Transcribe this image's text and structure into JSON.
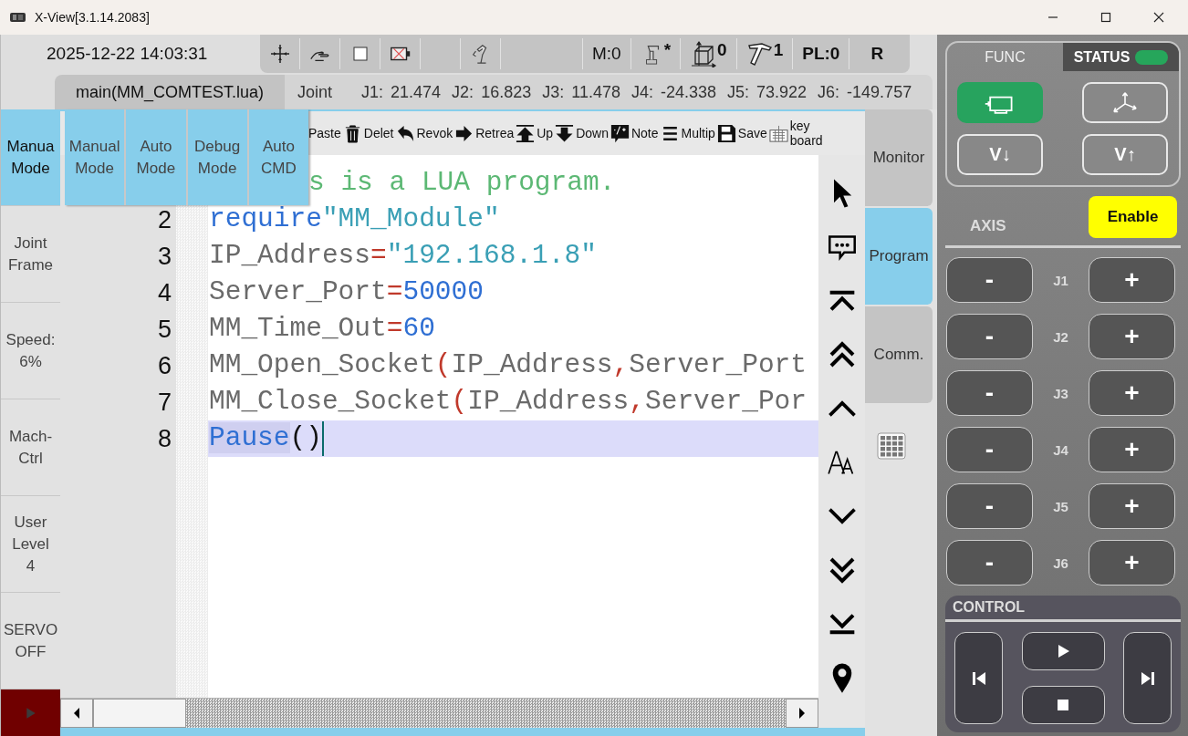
{
  "window": {
    "title": "X-View[3.1.14.2083]"
  },
  "header": {
    "datetime": "2025-12-22 14:03:31",
    "status": [
      {
        "kind": "plain",
        "text": "M:0"
      },
      {
        "kind": "robot",
        "text": "*"
      },
      {
        "kind": "frame",
        "text": "0"
      },
      {
        "kind": "tool",
        "text": "1"
      },
      {
        "kind": "bold",
        "text": "PL:0"
      },
      {
        "kind": "bold",
        "text": "R"
      }
    ]
  },
  "file_tab": {
    "label": "main(MM_COMTEST.lua)"
  },
  "joint_readout": {
    "label": "Joint",
    "values": [
      {
        "name": "J1:",
        "value": "21.474"
      },
      {
        "name": "J2:",
        "value": "16.823"
      },
      {
        "name": "J3:",
        "value": "11.478"
      },
      {
        "name": "J4:",
        "value": "-24.338"
      },
      {
        "name": "J5:",
        "value": "73.922"
      },
      {
        "name": "J6:",
        "value": "-149.757"
      }
    ]
  },
  "sidebar": [
    {
      "lines": [
        "Manua",
        "Mode"
      ],
      "selected": true
    },
    {
      "lines": [
        "Joint",
        "Frame"
      ],
      "selected": false
    },
    {
      "lines": [
        "Speed:",
        "6%"
      ],
      "selected": false
    },
    {
      "lines": [
        "Mach-",
        "Ctrl"
      ],
      "selected": false
    },
    {
      "lines": [
        "User",
        "Level",
        "4"
      ],
      "selected": false
    },
    {
      "lines": [
        "SERVO",
        "OFF"
      ],
      "selected": false
    }
  ],
  "mode_menu": [
    {
      "lines": [
        "Manual",
        "Mode"
      ]
    },
    {
      "lines": [
        "Auto",
        "Mode"
      ]
    },
    {
      "lines": [
        "Debug",
        "Mode"
      ]
    },
    {
      "lines": [
        "Auto",
        "CMD"
      ]
    }
  ],
  "editor_toolbar": [
    {
      "kind": "none",
      "lines": [
        "Paste"
      ]
    },
    {
      "kind": "delete",
      "lines": [
        "Delet"
      ]
    },
    {
      "kind": "revoke",
      "lines": [
        "Revok"
      ]
    },
    {
      "kind": "retreat",
      "lines": [
        "Retrea"
      ]
    },
    {
      "kind": "up",
      "lines": [
        "Up"
      ]
    },
    {
      "kind": "down",
      "lines": [
        "Down"
      ]
    },
    {
      "kind": "note",
      "lines": [
        "Note"
      ]
    },
    {
      "kind": "multi",
      "lines": [
        "Multip"
      ]
    },
    {
      "kind": "save",
      "lines": [
        "Save"
      ]
    },
    {
      "kind": "keyboard",
      "lines": [
        "key",
        "board"
      ]
    }
  ],
  "code_lines": [
    {
      "current": false,
      "tokens": [
        {
          "kind": "comment",
          "text": "s is a LUA program."
        }
      ]
    },
    {
      "number": "2",
      "current": false,
      "tokens": [
        {
          "kind": "keyword",
          "text": "require"
        },
        {
          "kind": "string",
          "text": "\"MM_Module\""
        }
      ]
    },
    {
      "number": "3",
      "current": false,
      "tokens": [
        {
          "kind": "ident",
          "text": "IP_Address"
        },
        {
          "kind": "op",
          "text": "="
        },
        {
          "kind": "string",
          "text": "\"192.168.1.8\""
        }
      ]
    },
    {
      "number": "4",
      "current": false,
      "tokens": [
        {
          "kind": "ident",
          "text": "Server_Port"
        },
        {
          "kind": "op",
          "text": "="
        },
        {
          "kind": "number",
          "text": "50000"
        }
      ]
    },
    {
      "number": "5",
      "current": false,
      "tokens": [
        {
          "kind": "ident",
          "text": "MM_Time_Out"
        },
        {
          "kind": "op",
          "text": "="
        },
        {
          "kind": "number",
          "text": "60"
        }
      ]
    },
    {
      "number": "6",
      "current": false,
      "tokens": [
        {
          "kind": "ident",
          "text": "MM_Open_Socket"
        },
        {
          "kind": "op",
          "text": "("
        },
        {
          "kind": "ident",
          "text": "IP_Address"
        },
        {
          "kind": "op",
          "text": ","
        },
        {
          "kind": "ident",
          "text": "Server_Port"
        }
      ]
    },
    {
      "number": "7",
      "current": false,
      "tokens": [
        {
          "kind": "ident",
          "text": "MM_Close_Socket"
        },
        {
          "kind": "op",
          "text": "("
        },
        {
          "kind": "ident",
          "text": "IP_Address"
        },
        {
          "kind": "op",
          "text": ","
        },
        {
          "kind": "ident",
          "text": "Server_Por"
        }
      ]
    },
    {
      "number": "8",
      "current": true,
      "tokens": [
        {
          "kind": "keyword",
          "text": "Pause"
        },
        {
          "kind": "punct",
          "text": "()"
        }
      ]
    }
  ],
  "side_tabs": [
    {
      "label": "Monitor",
      "selected": false
    },
    {
      "label": "Program",
      "selected": true
    },
    {
      "label": "Comm.",
      "selected": false
    }
  ],
  "right_panel": {
    "tabs": [
      {
        "label": "FUNC",
        "selected": true
      },
      {
        "label": "STATUS",
        "selected": false
      }
    ],
    "status_indicator": {
      "on": true
    },
    "func_buttons": [
      {
        "kind": "motor",
        "selected": true
      },
      {
        "kind": "axes",
        "selected": false
      },
      {
        "kind": "text",
        "label": "V↓",
        "selected": false
      },
      {
        "kind": "text",
        "label": "V↑",
        "selected": false
      }
    ],
    "axis_label": "AXIS",
    "enable_button": "Enable",
    "joints": [
      {
        "minus": "-",
        "label": "J1",
        "plus": "+"
      },
      {
        "minus": "-",
        "label": "J2",
        "plus": "+"
      },
      {
        "minus": "-",
        "label": "J3",
        "plus": "+"
      },
      {
        "minus": "-",
        "label": "J4",
        "plus": "+"
      },
      {
        "minus": "-",
        "label": "J5",
        "plus": "+"
      },
      {
        "minus": "-",
        "label": "J6",
        "plus": "+"
      }
    ],
    "control_title": "CONTROL"
  }
}
